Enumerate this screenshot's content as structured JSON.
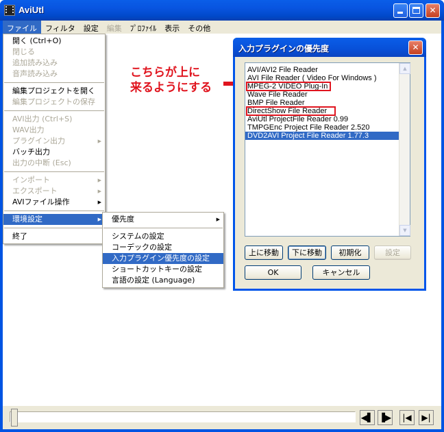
{
  "window": {
    "title": "AviUtl",
    "min_icon": "minimize-icon",
    "max_icon": "maximize-icon",
    "close_icon": "close-icon"
  },
  "menubar": [
    {
      "label": "ファイル",
      "state": "active"
    },
    {
      "label": "フィルタ",
      "state": "normal"
    },
    {
      "label": "設定",
      "state": "normal"
    },
    {
      "label": "編集",
      "state": "disabled"
    },
    {
      "label": "ﾌﾟﾛﾌｧｲﾙ",
      "state": "normal"
    },
    {
      "label": "表示",
      "state": "normal"
    },
    {
      "label": "その他",
      "state": "normal"
    }
  ],
  "file_menu": {
    "open": "開く (Ctrl+O)",
    "close": "閉じる",
    "add_load": "追加読み込み",
    "audio_load": "音声読み込み",
    "open_project": "編集プロジェクトを開く",
    "save_project": "編集プロジェクトの保存",
    "avi_output": "AVI出力 (Ctrl+S)",
    "wav_output": "WAV出力",
    "plugin_output": "プラグイン出力",
    "batch_output": "バッチ出力",
    "abort_output": "出力の中断 (Esc)",
    "import": "インポート",
    "export": "エクスポート",
    "avi_ops": "AVIファイル操作",
    "env_settings": "環境設定",
    "exit": "終了"
  },
  "env_menu": {
    "priority": "優先度",
    "system": "システムの設定",
    "codec": "コーデックの設定",
    "input_plugin_priority": "入力プラグイン優先度の設定",
    "shortcut": "ショートカットキーの設定",
    "language": "言語の設定 (Language)"
  },
  "dialog": {
    "title": "入力プラグインの優先度",
    "items": [
      "AVI/AVI2 File Reader",
      "AVI File Reader ( Video For Windows )",
      "MPEG-2 VIDEO Plug-In",
      "Wave File Reader",
      "BMP File Reader",
      "DirectShow File Reader",
      "AviUtl ProjectFile Reader 0.99",
      "TMPGEnc Project File Reader 2.520",
      "DVD2AVI Project File Reader 1.77.3"
    ],
    "selected_index": 8,
    "move_up": "上に移動",
    "move_down": "下に移動",
    "reset": "初期化",
    "settings": "設定",
    "ok": "OK",
    "cancel": "キャンセル"
  },
  "annotation": {
    "text": "こちらが上に\n来るようにする",
    "color": "#e0141e"
  },
  "colors": {
    "titlebar": "#0054e3",
    "selection": "#316ac5",
    "face": "#ece9d8"
  }
}
